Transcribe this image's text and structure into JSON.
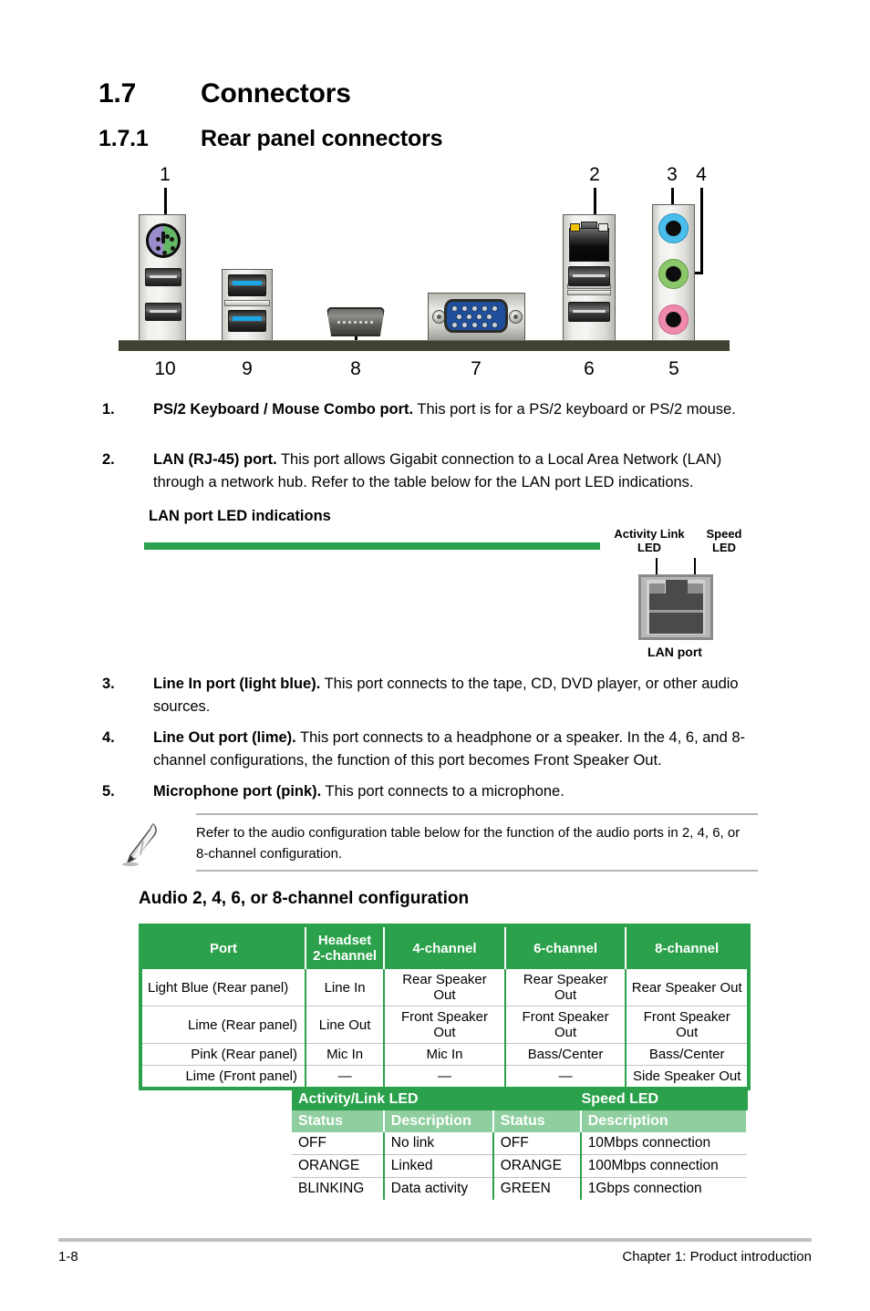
{
  "headings": {
    "section_number": "1.7",
    "section_title": "Connectors",
    "subsection_number": "1.7.1",
    "subsection_title": "Rear panel connectors"
  },
  "figure": {
    "callouts_top": [
      "1",
      "2",
      "3",
      "4"
    ],
    "callouts_bottom": [
      "10",
      "9",
      "8",
      "7",
      "6",
      "5"
    ],
    "ports": {
      "ps2": "ps2-combo-port",
      "usb2_left": "usb-2-port",
      "usb3": "usb-3-port",
      "hdmi": "hdmi-port",
      "vga": "vga-port",
      "lan": "lan-rj45-port",
      "audio_line_in": "line-in-jack",
      "audio_line_out": "line-out-jack",
      "audio_mic": "microphone-jack"
    },
    "colors": {
      "ps2_keyboard": "#9b8ccb",
      "ps2_mouse": "#63b765",
      "usb3_blue": "#19a8e8",
      "vga_blue": "#1f4f9c",
      "jack_line_in": "#49bdec",
      "jack_line_out": "#8cc76a",
      "jack_mic": "#ef8aae",
      "lan_led_activity": "#f2c200",
      "lan_led_speed": "#e9e9e6"
    }
  },
  "items": [
    {
      "number": "1.",
      "bold": "PS/2 Keyboard / Mouse Combo port.",
      "text": " This port is for a PS/2 keyboard or PS/2 mouse."
    },
    {
      "number": "2.",
      "bold": "LAN (RJ-45) port.",
      "text": " This port allows Gigabit connection to a Local Area Network (LAN) through a network hub. Refer to the table below for the LAN port LED indications."
    },
    {
      "number": "3.",
      "bold": "Line In port (light blue).",
      "text": " This port connects to the tape, CD, DVD player, or other audio sources."
    },
    {
      "number": "4.",
      "bold": "Line Out port (lime).",
      "text": " This port connects to a headphone or a speaker. In the 4, 6, and 8-channel configurations, the function of this port becomes Front Speaker Out."
    },
    {
      "number": "5.",
      "bold": "Microphone port (pink).",
      "text": " This port connects to a microphone."
    }
  ],
  "lan_led": {
    "caption": "LAN port LED indications",
    "group_headers": [
      "Activity/Link LED",
      "Speed LED"
    ],
    "sub_headers": [
      "Status",
      "Description",
      "Status",
      "Description"
    ],
    "rows": [
      [
        "OFF",
        "No link",
        "OFF",
        "10Mbps connection"
      ],
      [
        "ORANGE",
        "Linked",
        "ORANGE",
        "100Mbps connection"
      ],
      [
        "BLINKING",
        "Data activity",
        "GREEN",
        "1Gbps connection"
      ]
    ],
    "header_color": "#2aa14a",
    "subheader_color": "#8fce9f"
  },
  "lan_illustration": {
    "label_activity": "Activity Link\nLED",
    "label_activity_line1": "Activity Link",
    "label_activity_line2": "LED",
    "label_speed_line1": "Speed",
    "label_speed_line2": "LED",
    "caption": "LAN port"
  },
  "note": {
    "icon": "pencil-icon",
    "text": "Refer to the audio configuration table below for the function of the audio ports in 2, 4, 6, or 8-channel configuration."
  },
  "audio_config": {
    "heading": "Audio 2, 4, 6, or 8-channel configuration",
    "headers": [
      "Port",
      "Headset\n2-channel",
      "4-channel",
      "6-channel",
      "8-channel"
    ],
    "header_port": "Port",
    "header_headset_line1": "Headset",
    "header_headset_line2": "2-channel",
    "header_4ch": "4-channel",
    "header_6ch": "6-channel",
    "header_8ch": "8-channel",
    "rows": [
      [
        "Light Blue (Rear panel)",
        "Line In",
        "Rear Speaker Out",
        "Rear Speaker Out",
        "Rear Speaker Out"
      ],
      [
        "Lime (Rear panel)",
        "Line Out",
        "Front Speaker Out",
        "Front Speaker Out",
        "Front Speaker Out"
      ],
      [
        "Pink (Rear panel)",
        "Mic In",
        "Mic In",
        "Bass/Center",
        "Bass/Center"
      ],
      [
        "Lime (Front panel)",
        "—",
        "—",
        "—",
        "Side Speaker Out"
      ]
    ]
  },
  "footer": {
    "page_number": "1-8",
    "chapter": "Chapter 1: Product introduction"
  }
}
